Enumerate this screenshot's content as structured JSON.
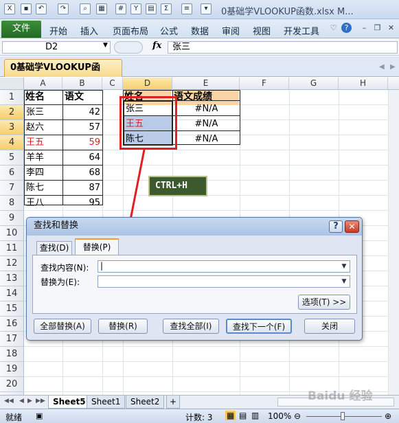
{
  "titlebar": {
    "title": "0基础学VLOOKUP函数.xlsx M...",
    "qa_icons": [
      "save-icon",
      "undo-icon",
      "redo-icon",
      "print-preview-icon",
      "format-icon",
      "calc-icon",
      "filter-icon",
      "sum-icon",
      "align-icon",
      "customize-icon"
    ]
  },
  "ribbon": {
    "file": "文件",
    "tabs": [
      "开始",
      "插入",
      "页面布局",
      "公式",
      "数据",
      "审阅",
      "视图",
      "开发工具"
    ]
  },
  "formula": {
    "name_box": "D2",
    "fx": "fx",
    "value": "张三"
  },
  "workbook": {
    "tab": "0基础学VLOOKUP函数.xlsx"
  },
  "grid": {
    "columns": [
      "A",
      "B",
      "C",
      "D",
      "E",
      "F",
      "G",
      "H"
    ],
    "rows": [
      "1",
      "2",
      "3",
      "4",
      "5",
      "6",
      "7",
      "8",
      "9",
      "10",
      "11",
      "12",
      "13",
      "14",
      "15",
      "16",
      "17",
      "18",
      "19",
      "20",
      "21",
      "22"
    ],
    "a_header": "姓名",
    "b_header": "语文",
    "a_values": [
      "张三",
      "赵六",
      "王五",
      "羊羊",
      "李四",
      "陈七",
      "王八"
    ],
    "b_values": [
      "42",
      "57",
      "59",
      "64",
      "68",
      "87",
      "95"
    ],
    "d_header": "姓名",
    "e_header": "语文成绩",
    "d_values": [
      "张三",
      "王五",
      "陈七"
    ],
    "e_values": [
      "#N/A",
      "#N/A",
      "#N/A"
    ],
    "red_color": "#e02020"
  },
  "callout": {
    "label": "CTRL+H"
  },
  "dialog": {
    "title": "查找和替换",
    "help": "?",
    "close": "✕",
    "tab_find": "查找(D)",
    "tab_replace": "替换(P)",
    "find_label": "查找内容(N):",
    "replace_label": "替换为(E):",
    "find_value": "|",
    "replace_value": "",
    "options": "选项(T) >>",
    "buttons": [
      "全部替换(A)",
      "替换(R)",
      "查找全部(I)",
      "查找下一个(F)",
      "关闭"
    ]
  },
  "sheets": {
    "tabs": [
      "Sheet5",
      "Sheet1",
      "Sheet2"
    ]
  },
  "status": {
    "ready": "就绪",
    "count": "计数: 3",
    "zoom": "100%"
  },
  "watermark": "Baidu 经验"
}
